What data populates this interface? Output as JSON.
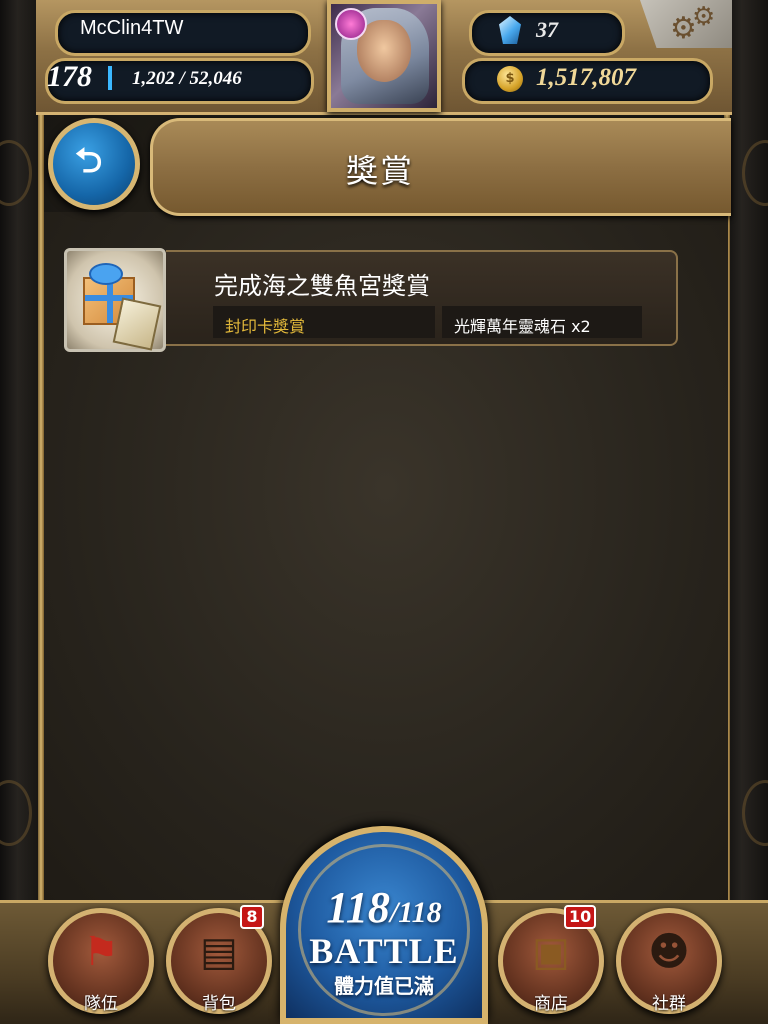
{
  "player": {
    "name": "McClin4TW",
    "level": "178",
    "xp_current": "1,202",
    "xp_total": "52,046",
    "xp_fraction": 0.023,
    "gems": "37",
    "coins": "1,517,807"
  },
  "icons": {
    "gem": "blue-gem-icon",
    "coin": "gold-coin-icon",
    "settings": "gear-icon",
    "back": "return-arrow-icon"
  },
  "page": {
    "title": "獎賞"
  },
  "rewards": [
    {
      "title": "完成海之雙魚宮獎賞",
      "type": "封印卡獎賞",
      "item": "光輝萬年靈魂石 x2"
    }
  ],
  "battle": {
    "stamina_current": "118",
    "separator": "/",
    "stamina_max": "118",
    "label": "BATTLE",
    "status": "體力值已滿"
  },
  "nav": {
    "team": {
      "label": "隊伍",
      "icon": "red-flag-icon"
    },
    "bag": {
      "label": "背包",
      "badge": "8",
      "icon": "bag-icon"
    },
    "shop": {
      "label": "商店",
      "badge": "10",
      "icon": "treasure-chest-icon"
    },
    "social": {
      "label": "社群",
      "icon": "people-icon"
    }
  },
  "colors": {
    "gold_trim": "#c9a864",
    "reward_type_text": "#e3b93a",
    "battle_blue": "#1e5aa0",
    "badge_red": "#c51616",
    "xp_bar": "#3bb8ff"
  }
}
